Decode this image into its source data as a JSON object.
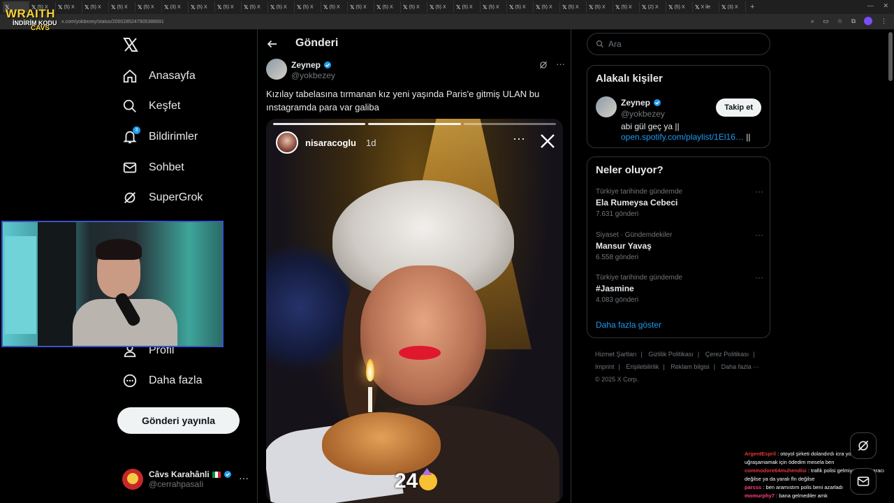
{
  "browser": {
    "tabs": [
      {
        "label": "",
        "active": true
      },
      {
        "label": "(5) X"
      },
      {
        "label": "(5) X"
      },
      {
        "label": "(5) X"
      },
      {
        "label": "(5) X"
      },
      {
        "label": "(5) X"
      },
      {
        "label": "(3) X"
      },
      {
        "label": "(5) X"
      },
      {
        "label": "(5) X"
      },
      {
        "label": "(5) X"
      },
      {
        "label": "(5) X"
      },
      {
        "label": "(5) X"
      },
      {
        "label": "(5) X"
      },
      {
        "label": "(5) X"
      },
      {
        "label": "(5) X"
      },
      {
        "label": "(5) X"
      },
      {
        "label": "(5) X"
      },
      {
        "label": "(5) X"
      },
      {
        "label": "(5) X"
      },
      {
        "label": "(5) X"
      },
      {
        "label": "(5) X"
      },
      {
        "label": "(5) X"
      },
      {
        "label": "(5) X"
      },
      {
        "label": "(5) X"
      },
      {
        "label": "(2) X"
      },
      {
        "label": "(5) X"
      },
      {
        "label": "X ile"
      },
      {
        "label": "(3) X"
      }
    ],
    "url": "x.com/yokbezey/status/2000285247905386691"
  },
  "overlay": {
    "brand": "WRAITH",
    "promo": "İNDİRİM KODU",
    "code": "CAVS"
  },
  "nav": {
    "items": [
      {
        "label": "Anasayfa"
      },
      {
        "label": "Keşfet"
      },
      {
        "label": "Bildirimler",
        "badge": "3"
      },
      {
        "label": "Sohbet"
      },
      {
        "label": "SuperGrok"
      },
      {
        "label": "Profil"
      },
      {
        "label": "Daha fazla"
      }
    ],
    "post_button": "Gönderi yayınla",
    "account": {
      "name": "Câvs Karahânli",
      "handle": "@cerrahpasaIi"
    }
  },
  "post": {
    "header": "Gönderi",
    "author_name": "Zeynep",
    "author_handle": "@yokbezey",
    "text": "Kızılay tabelasına tırmanan kız yeni yaşında Paris'e gitmiş ULAN bu ınstagramda para var galiba",
    "story": {
      "user": "nisaracoglu",
      "time": "1d",
      "age_text": "24"
    }
  },
  "right": {
    "search_placeholder": "Ara",
    "related_title": "Alakalı kişiler",
    "related": {
      "name": "Zeynep",
      "handle": "@yokbezey",
      "follow": "Takip et",
      "bio_line1": "abi gül geç ya ||",
      "bio_link": "open.spotify.com/playlist/1El16…",
      "bio_sep": "||"
    },
    "trends_title": "Neler oluyor?",
    "trends": [
      {
        "context": "Türkiye tarihinde gündemde",
        "topic": "Ela Rumeysa Cebeci",
        "count": "7.631 gönderi"
      },
      {
        "context": "Siyaset · Gündemdekiler",
        "topic": "Mansur Yavaş",
        "count": "6.558 gönderi"
      },
      {
        "context": "Türkiye tarihinde gündemde",
        "topic": "#Jasmine",
        "count": "4.083 gönderi"
      }
    ],
    "show_more": "Daha fazla göster",
    "footer": [
      "Hizmet Şartları",
      "|",
      "Gizlilik Politikası",
      "|",
      "Çerez Politikası",
      "|",
      "Imprint",
      "|",
      "Erişilebilirlik",
      "|",
      "Reklam bilgisi",
      "|",
      "Daha fazla ···",
      "© 2025 X Corp."
    ]
  },
  "chat": [
    {
      "user": "ArgentEspril",
      "msg": ": otoyol şirketi dolandırdı icra yolladı uğraşamamak için ödedim mesela ben"
    },
    {
      "user": "commodore64muhendisi",
      "msg": ": trafik polisi gelmiyor kmau aracı değilse ya da yaralı fln değilse"
    },
    {
      "user": "parsss",
      "msg": ": ben aramıstım polis beni azarladı"
    },
    {
      "user": "momurphy7",
      "msg": ": bana gelmediler amk"
    }
  ],
  "colors": {
    "accent": "#1d9bf0",
    "background": "#000000",
    "border": "#2f3336",
    "muted": "#71767b",
    "brand_yellow": "#f7d33a",
    "webcam_border": "#3a55c9"
  }
}
